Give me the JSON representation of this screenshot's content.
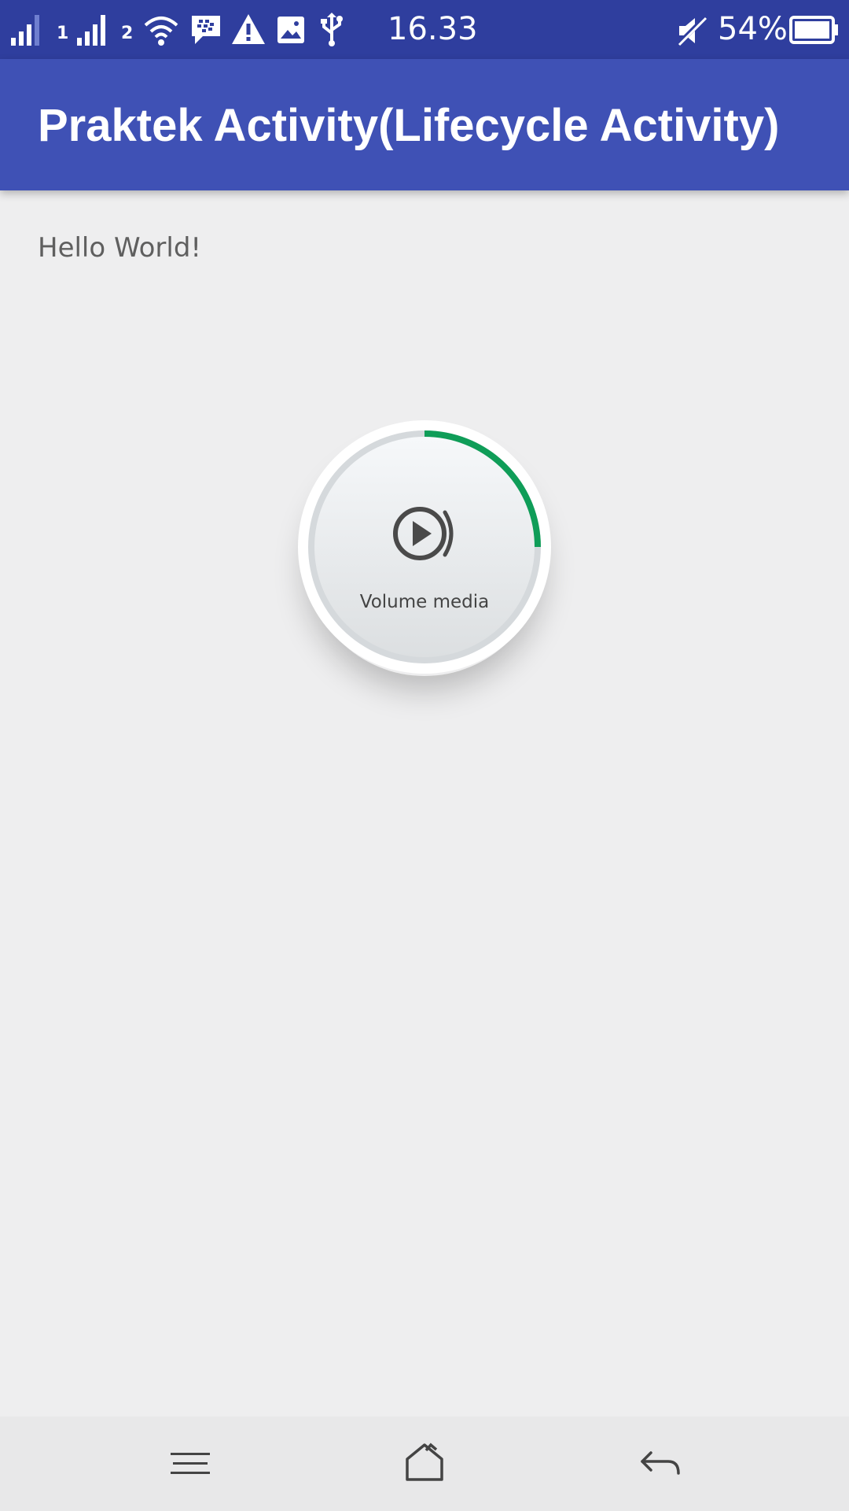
{
  "status_bar": {
    "time": "16.33",
    "battery_percent": "54%",
    "sim1_label": "1",
    "sim2_label": "2",
    "icons": [
      "signal-sim1-icon",
      "signal-sim2-icon",
      "wifi-icon",
      "bbm-icon",
      "warning-icon",
      "image-icon",
      "usb-icon",
      "mute-icon",
      "battery-icon"
    ],
    "battery_level": 0.54
  },
  "app_bar": {
    "title": "Praktek Activity(Lifecycle Activity)"
  },
  "main": {
    "hello_text": "Hello World!"
  },
  "volume_overlay": {
    "label": "Volume media",
    "icon": "media-play-icon",
    "level": 0.25,
    "accent_color": "#0f9d58"
  },
  "nav_bar": {
    "icons": [
      "menu-icon",
      "home-icon",
      "back-icon"
    ]
  },
  "colors": {
    "status_bar": "#2f3e9e",
    "app_bar": "#3f51b5",
    "background": "#eeeeef",
    "nav_bar": "#e8e8e9"
  }
}
